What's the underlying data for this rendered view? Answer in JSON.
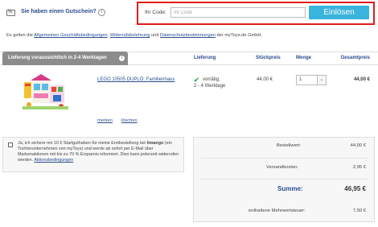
{
  "voucher": {
    "question": "Sie haben einen Gutschein?",
    "info_glyph": "i",
    "code_label": "Ihr Code:",
    "code_placeholder": "Ihr Code",
    "redeem_label": "Einlösen"
  },
  "agb": {
    "prefix": "Es gelten die ",
    "terms_link": "Allgemeinen Geschäftsbedingungen",
    "sep1": ", ",
    "withdrawal_link": "Widerrufsbelehrung",
    "sep2": " und ",
    "privacy_link": "Datenschutzbestimmungen",
    "suffix": " der myToys.de GmbH."
  },
  "table": {
    "delivery_tab": "Lieferung voraussichtlich in 2-4 Werktagen",
    "info_glyph": "i",
    "col_delivery": "Lieferung",
    "col_unit_price": "Stückpreis",
    "col_quantity": "Menge",
    "col_total": "Gesamtpreis"
  },
  "item": {
    "name": "LEGO 10505 DUPLO: Familienhaus",
    "stock": "vorrätig,",
    "delivery": "2 - 4 Werktage",
    "unit_price": "44,00 €",
    "quantity": "1",
    "total_price": "44,00 €",
    "remember_label": "merken",
    "delete_label": "löschen",
    "check_glyph": "✔",
    "select_arrow": "⌄"
  },
  "consent": {
    "text": "Ja, ich sichere mir 10 € Startguthaben für meine Erstbestellung bei ",
    "brand": "limango",
    "text2": " (ein Tochterunternehmen von myToys) und werde ab sofort per E-Mail über Markenaktionen mit bis zu 70 % Ersparnis informiert. Dies kann jederzeit widerrufen werden. ",
    "link": "Aktionsbedingungen"
  },
  "summary": {
    "order_label": "Bestellwert:",
    "order_value": "44,00 €",
    "shipping_label": "Versandkosten:",
    "shipping_value": "2,95 €",
    "sum_label": "Summe:",
    "sum_value": "46,95 €",
    "vat_label": "enthaltene Mehrwertsteuer:",
    "vat_value": "7,50 €"
  },
  "colors": {
    "accent": "#39b4dd",
    "highlight_border": "#e01c1c",
    "link": "#2a4d8f",
    "in_stock": "#2fa84f"
  }
}
